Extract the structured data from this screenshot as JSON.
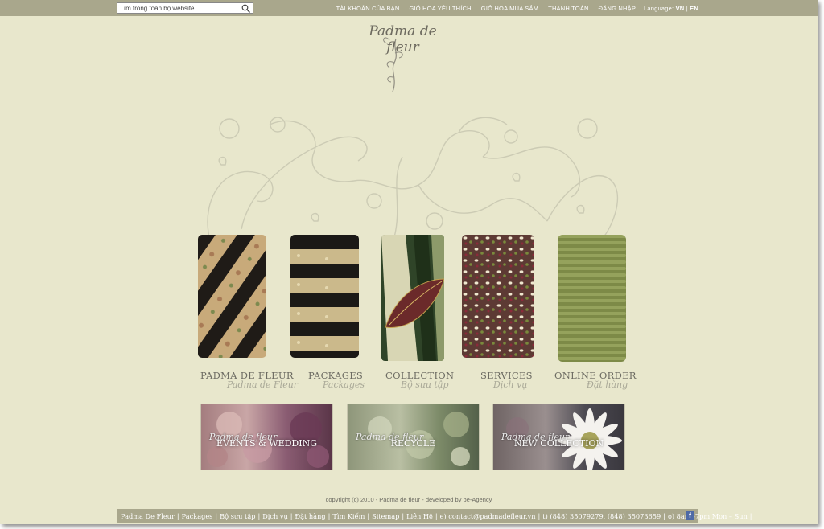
{
  "search": {
    "placeholder": "Tìm trong toàn bộ website..."
  },
  "topnav": [
    "TÀI KHOẢN CỦA BẠN",
    "GIỎ HOA YÊU THÍCH",
    "GIỎ HOA MUA SẮM",
    "THANH TOÁN",
    "ĐĂNG NHẬP"
  ],
  "language": {
    "label": "Language:",
    "vn": "VN",
    "sep": "|",
    "en": "EN"
  },
  "logo": "Padma de fleur",
  "columns": [
    {
      "title": "PADMA DE FLEUR",
      "subtitle": "Padma de Fleur"
    },
    {
      "title": "PACKAGES",
      "subtitle": "Packages"
    },
    {
      "title": "COLLECTION",
      "subtitle": "Bộ sưu tập"
    },
    {
      "title": "SERVICES",
      "subtitle": "Dịch vụ"
    },
    {
      "title": "ONLINE ORDER",
      "subtitle": "Đặt hàng"
    }
  ],
  "banners": [
    {
      "brand": "Padma de fleur",
      "title": "EVENTS & WEDDING"
    },
    {
      "brand": "Padma de fleur",
      "title": "RECYCLE"
    },
    {
      "brand": "Padma de fleur",
      "title": "NEW COLLECTION"
    }
  ],
  "copyright": "copyright (c) 2010 - Padma de fleur - developed by  be-Agency",
  "footer": {
    "links": [
      "Padma De Fleur",
      "Packages",
      "Bộ sưu tập",
      "Dịch vụ",
      "Đặt hàng",
      "Tìm Kiếm",
      "Sitemap",
      "Liên Hệ"
    ],
    "email": "e) contact@padmadefleur.vn",
    "phone": "t) (848) 35079279, (848) 35073659",
    "hours": "o) 8am -7pm Mon – Sun",
    "social_icon": "facebook-icon"
  },
  "colors": {
    "page_bg": "#e8e7cc",
    "bar": "#a9a78c",
    "text": "#6c6b62"
  }
}
